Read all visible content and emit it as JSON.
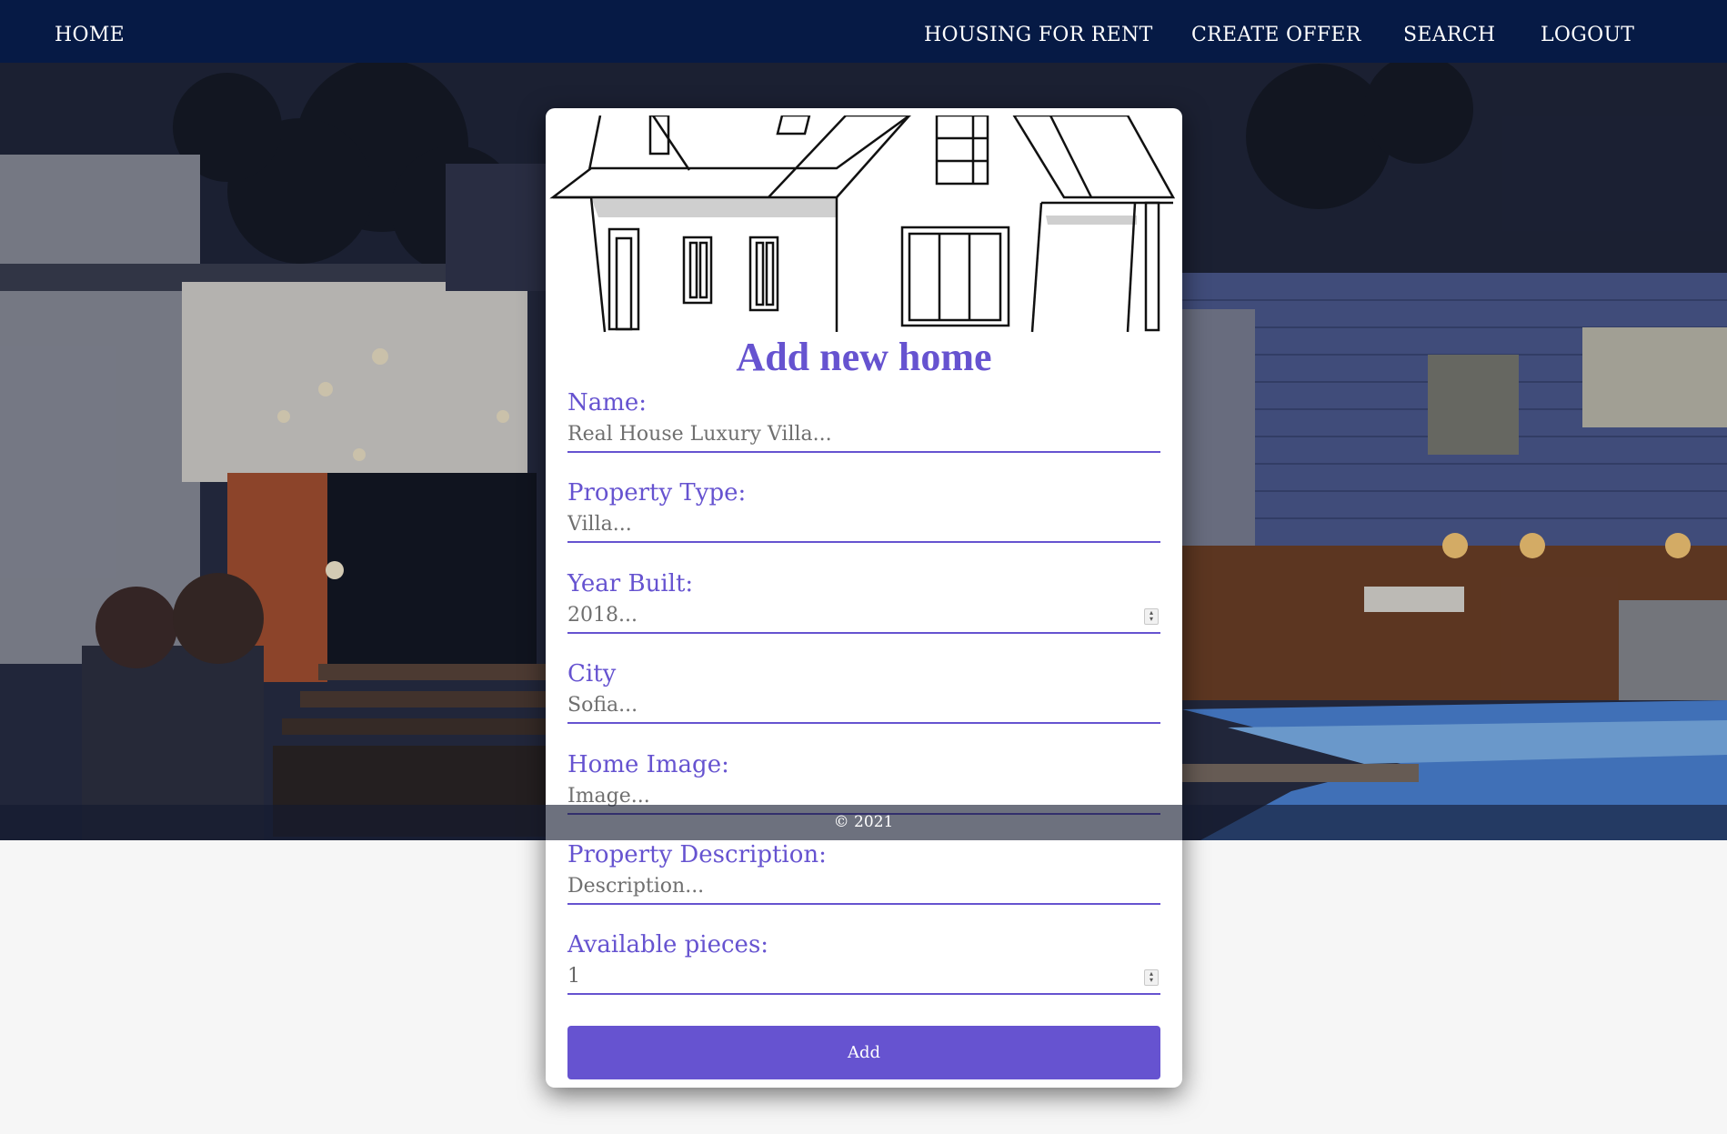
{
  "nav": {
    "home": "HOME",
    "housing_for_rent": "HOUSING FOR RENT",
    "create_offer": "CREATE OFFER",
    "search": "SEARCH",
    "logout": "LOGOUT"
  },
  "form": {
    "title": "Add new home",
    "fields": [
      {
        "label": "Name:",
        "placeholder": "Real House Luxury Villa..."
      },
      {
        "label": "Property Type:",
        "placeholder": "Villa..."
      },
      {
        "label": "Year Built:",
        "placeholder": "2018..."
      },
      {
        "label": "City",
        "placeholder": "Sofia..."
      },
      {
        "label": "Home Image:",
        "placeholder": "Image..."
      },
      {
        "label": "Property Description:",
        "placeholder": "Description..."
      },
      {
        "label": "Available pieces:",
        "value": "1"
      }
    ],
    "submit_label": "Add"
  },
  "footer": {
    "text": "© 2021"
  },
  "colors": {
    "nav_bg": "#061a45",
    "accent": "#6653d0"
  }
}
